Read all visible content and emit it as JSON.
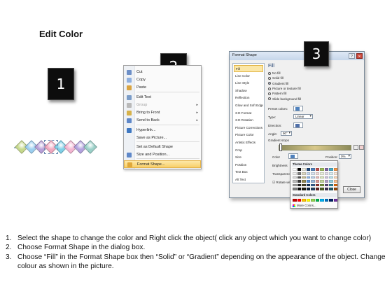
{
  "title": "Edit Color",
  "steps": {
    "badge1": "1",
    "badge2": "2",
    "badge3": "3"
  },
  "diamond_colors": [
    "#c6d98c",
    "#9ccff0",
    "#b8a0d8",
    "#f0a8c0",
    "#7fd0e8",
    "#f4b6d2",
    "#b3a2df",
    "#9ad0c8"
  ],
  "context_menu": {
    "items": [
      {
        "label": "Cut",
        "icon": "scissors-icon",
        "color": "#6d8fc7"
      },
      {
        "label": "Copy",
        "icon": "copy-icon",
        "color": "#8fb0df"
      },
      {
        "label": "Paste",
        "icon": "paste-icon",
        "color": "#d9a441"
      },
      {
        "label": "Edit Text",
        "icon": "edit-text-icon",
        "color": "#7a9cc8"
      },
      {
        "label": "Group",
        "icon": "group-icon",
        "color": "#b9b9b9"
      },
      {
        "label": "Bring to Front",
        "icon": "bring-to-front-icon",
        "color": "#d7b24a"
      },
      {
        "label": "Send to Back",
        "icon": "send-to-back-icon",
        "color": "#5f88c9"
      },
      {
        "label": "Hyperlink...",
        "icon": "hyperlink-icon",
        "color": "#3e78c2"
      },
      {
        "label": "Save as Picture...",
        "icon": "",
        "color": ""
      },
      {
        "label": "Set as Default Shape",
        "icon": "",
        "color": ""
      },
      {
        "label": "Size and Position...",
        "icon": "size-position-icon",
        "color": "#5f88c9"
      },
      {
        "label": "Format Shape...",
        "icon": "format-shape-icon",
        "color": "#e0a83a"
      }
    ]
  },
  "dialog": {
    "title": "Format Shape",
    "nav": [
      "Fill",
      "Line Color",
      "Line Style",
      "Shadow",
      "Reflection",
      "Glow and Soft Edges",
      "3-D Format",
      "3-D Rotation",
      "Picture Corrections",
      "Picture Color",
      "Artistic Effects",
      "Crop",
      "Size",
      "Position",
      "Text Box",
      "Alt Text"
    ],
    "heading": "Fill",
    "options": [
      "No fill",
      "Solid fill",
      "Gradient fill",
      "Picture or texture fill",
      "Pattern fill",
      "Slide background fill"
    ],
    "preset_label": "Preset colors:",
    "type_label": "Type:",
    "type_value": "Linear",
    "direction_label": "Direction:",
    "angle_label": "Angle:",
    "angle_value": "90°",
    "gradient_stops_label": "Gradient stops",
    "color_label": "Color",
    "position_label": "Position:",
    "position_value": "0%",
    "brightness_label": "Brightness",
    "transparency_label": "Transparency",
    "rotate_label": "Rotate with shape",
    "close_label": "Close"
  },
  "palette": {
    "theme_label": "Theme Colors",
    "standard_label": "Standard Colors",
    "more_label": "More Colors...",
    "theme_top": [
      "#ffffff",
      "#000000",
      "#eeece1",
      "#1f497d",
      "#4f81bd",
      "#c0504d",
      "#9bbb59",
      "#8064a2",
      "#4bacc6",
      "#f79646"
    ],
    "theme_shades": [
      [
        "#f2f2f2",
        "#7f7f7f",
        "#ddd9c3",
        "#c6d9f0",
        "#dbe5f1",
        "#f2dcdb",
        "#ebf1dd",
        "#e5e0ec",
        "#dbeef3",
        "#fdeada"
      ],
      [
        "#d8d8d8",
        "#595959",
        "#c4bd97",
        "#8db3e2",
        "#b8cce4",
        "#e5b9b7",
        "#d7e3bc",
        "#ccc1d9",
        "#b7dde8",
        "#fbd5b5"
      ],
      [
        "#bfbfbf",
        "#3f3f3f",
        "#938953",
        "#548dd4",
        "#95b3d7",
        "#d99694",
        "#c3d69b",
        "#b2a2c7",
        "#92cddc",
        "#fac08f"
      ],
      [
        "#a5a5a5",
        "#262626",
        "#494429",
        "#17365d",
        "#366092",
        "#953734",
        "#76923c",
        "#5f497a",
        "#31859b",
        "#e36c09"
      ],
      [
        "#7f7f7f",
        "#0c0c0c",
        "#1d1b10",
        "#0f243e",
        "#244061",
        "#632423",
        "#4f6128",
        "#3f3151",
        "#205867",
        "#974806"
      ]
    ],
    "standard": [
      "#c00000",
      "#ff0000",
      "#ffc000",
      "#ffff00",
      "#92d050",
      "#00b050",
      "#00b0f0",
      "#0070c0",
      "#002060",
      "#7030a0"
    ]
  },
  "instructions": [
    {
      "num": "1.",
      "text": "Select the shape to change the color and Right click the object( click any object which you want to change color)"
    },
    {
      "num": "2.",
      "text": "Choose Format Shape in the dialog box."
    },
    {
      "num": "3.",
      "text": "Choose “Fill” in the Format Shape box then “Solid” or “Gradient” depending on the appearance of the object. Change colour as shown in the picture."
    }
  ]
}
